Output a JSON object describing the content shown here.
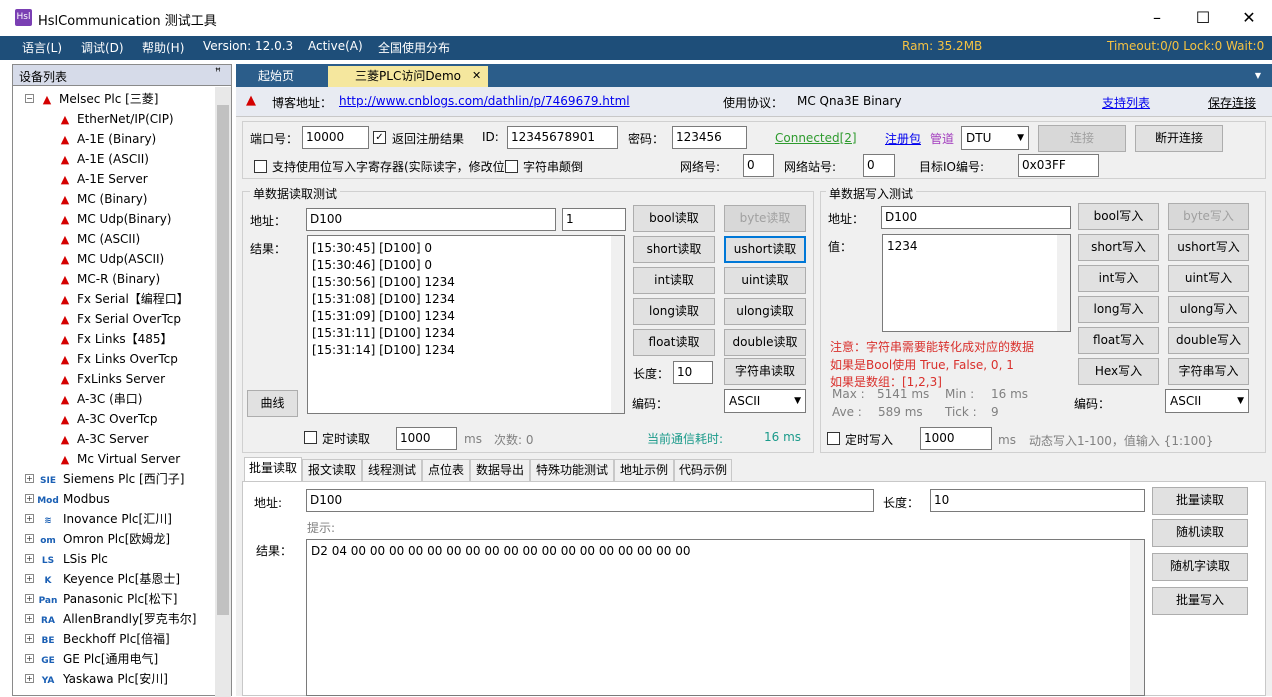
{
  "window": {
    "title": "HslCommunication 测试工具",
    "icon": "Hsl",
    "min": "–",
    "max": "☐",
    "close": "✕"
  },
  "menu": {
    "items": [
      "语言(L)",
      "调试(D)",
      "帮助(H)"
    ],
    "version": "Version: 12.0.3",
    "active": "Active(A)",
    "dist": "全国使用分布",
    "ram": "Ram: 35.2MB",
    "status": "Timeout:0/0  Lock:0  Wait:0"
  },
  "devices": {
    "header": "设备列表",
    "pin": "📌",
    "root": "Melsec Plc [三菱]",
    "children": [
      "EtherNet/IP(CIP)",
      "A-1E (Binary)",
      "A-1E (ASCII)",
      "A-1E Server",
      "MC (Binary)",
      "MC Udp(Binary)",
      "MC (ASCII)",
      "MC Udp(ASCII)",
      "MC-R (Binary)",
      "Fx Serial【编程口】",
      "Fx Serial OverTcp",
      "Fx Links【485】",
      "Fx Links OverTcp",
      "FxLinks Server",
      "A-3C (串口)",
      "A-3C OverTcp",
      "A-3C Server",
      "Mc Virtual Server"
    ],
    "vendors": [
      {
        "label": "Siemens Plc [西门子]",
        "icon": "SIE"
      },
      {
        "label": "Modbus",
        "icon": "Mod"
      },
      {
        "label": "Inovance Plc[汇川]",
        "icon": "≋"
      },
      {
        "label": "Omron Plc[欧姆龙]",
        "icon": "om"
      },
      {
        "label": "LSis Plc",
        "icon": "LS"
      },
      {
        "label": "Keyence Plc[基恩士]",
        "icon": "K"
      },
      {
        "label": "Panasonic Plc[松下]",
        "icon": "Pan"
      },
      {
        "label": "AllenBrandly[罗克韦尔]",
        "icon": "RA"
      },
      {
        "label": "Beckhoff Plc[倍福]",
        "icon": "BE"
      },
      {
        "label": "GE Plc[通用电气]",
        "icon": "GE"
      },
      {
        "label": "Yaskawa Plc[安川]",
        "icon": "YA"
      }
    ]
  },
  "tabs": {
    "home": "起始页",
    "demo": "三菱PLC访问Demo",
    "close": "✕",
    "menu": "▼"
  },
  "info": {
    "blog_label": "博客地址：",
    "blog_url": "http://www.cnblogs.com/dathlin/p/7469679.html",
    "protocol_label": "使用协议：",
    "protocol": "MC Qna3E Binary",
    "support": "支持列表",
    "save": "保存连接"
  },
  "conn": {
    "port_label": "端口号：",
    "port": "10000",
    "return_reg": "返回注册结果",
    "id_label": "ID:",
    "id": "12345678901",
    "pwd_label": "密码：",
    "pwd": "123456",
    "connected": "Connected[2]",
    "register": "注册包",
    "pipe": "管道",
    "mode": "DTU",
    "connect": "连接",
    "disconnect": "断开连接",
    "bitwrite": "支持使用位写入字寄存器(实际读字，修改位",
    "reverse": "字符串颠倒",
    "net_label": "网络号:",
    "net": "0",
    "station_label": "网络站号:",
    "station": "0",
    "io_label": "目标IO编号:",
    "io": "0x03FF"
  },
  "read": {
    "title": "单数据读取测试",
    "addr_label": "地址：",
    "addr": "D100",
    "len": "1",
    "result_label": "结果：",
    "lines": [
      "[15:30:45] [D100] 0",
      "[15:30:46] [D100] 0",
      "[15:30:56] [D100] 1234",
      "[15:31:08] [D100] 1234",
      "[15:31:09] [D100] 1234",
      "[15:31:11] [D100] 1234",
      "[15:31:14] [D100] 1234"
    ],
    "curve": "曲线",
    "buttons": [
      "bool读取",
      "byte读取",
      "short读取",
      "ushort读取",
      "int读取",
      "uint读取",
      "long读取",
      "ulong读取",
      "float读取",
      "double读取"
    ],
    "len_label": "长度：",
    "strlen": "10",
    "str_btn": "字符串读取",
    "enc_label": "编码：",
    "enc": "ASCII",
    "timer": "定时读取",
    "interval": "1000",
    "ms": "ms",
    "count": "次数: 0",
    "elapsed_label": "当前通信耗时:",
    "elapsed": "16 ms"
  },
  "write": {
    "title": "单数据写入测试",
    "addr_label": "地址：",
    "addr": "D100",
    "val_label": "值：",
    "val": "1234",
    "buttons": [
      "bool写入",
      "byte写入",
      "short写入",
      "ushort写入",
      "int写入",
      "uint写入",
      "long写入",
      "ulong写入",
      "float写入",
      "double写入",
      "Hex写入",
      "字符串写入"
    ],
    "notes": [
      "注意：字符串需要能转化成对应的数据",
      "如果是Bool使用 True, False, 0, 1",
      "如果是数组：[1,2,3]"
    ],
    "max": "Max :",
    "max_v": "5141 ms",
    "min": "Min :",
    "min_v": "16 ms",
    "ave": "Ave :",
    "ave_v": "589 ms",
    "tick": "Tick :",
    "tick_v": "9",
    "enc_label": "编码：",
    "enc": "ASCII",
    "timer": "定时写入",
    "interval": "1000",
    "ms": "ms",
    "dyn": "动态写入1-100，值输入 {1:100}"
  },
  "lower": {
    "tabs": [
      "批量读取",
      "报文读取",
      "线程测试",
      "点位表",
      "数据导出",
      "特殊功能测试",
      "地址示例",
      "代码示例"
    ],
    "addr_label": "地址:",
    "addr": "D100",
    "len_label": "长度：",
    "len": "10",
    "hint": "提示:",
    "result_label": "结果：",
    "result": "D2 04 00 00 00 00 00 00 00 00 00 00 00 00 00 00 00 00 00 00",
    "buttons": [
      "批量读取",
      "随机读取",
      "随机字读取",
      "批量写入"
    ]
  }
}
